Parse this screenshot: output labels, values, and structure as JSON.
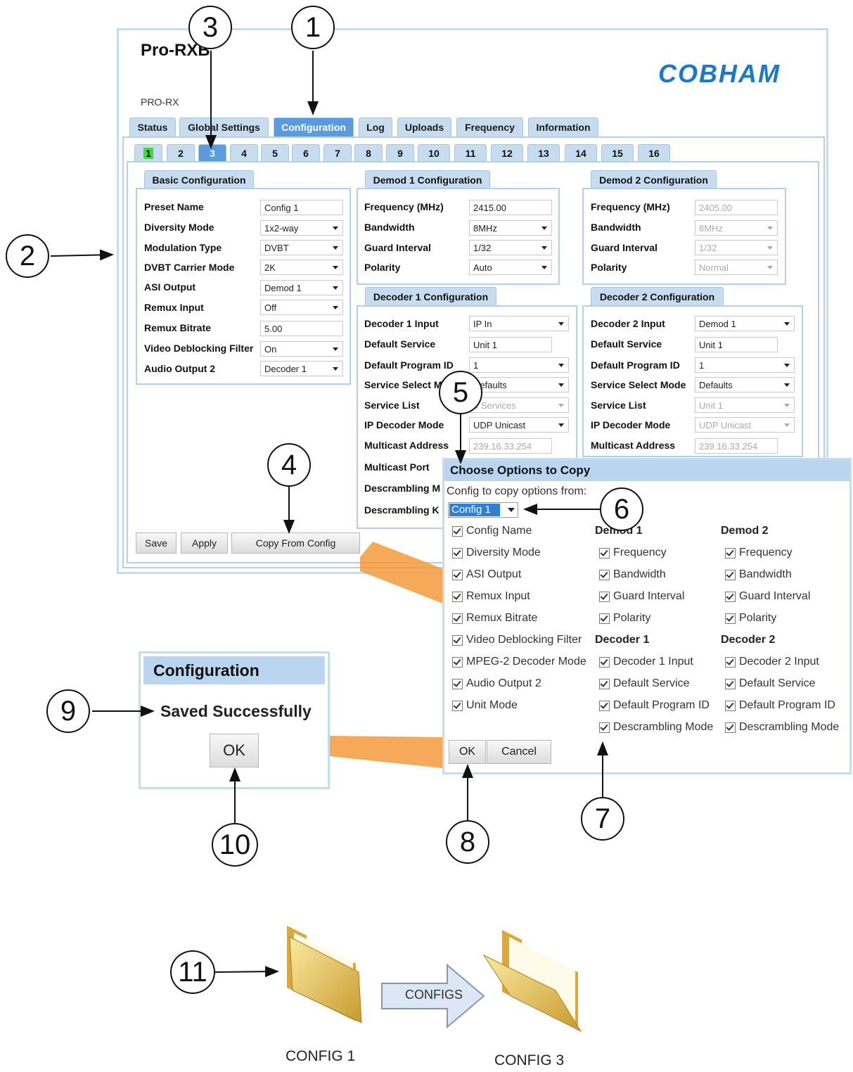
{
  "app": {
    "title": "Pro-RXB",
    "subtitle": "PRO-RX",
    "logo": "COBHAM"
  },
  "main_tabs": [
    "Status",
    "Global Settings",
    "Configuration",
    "Log",
    "Uploads",
    "Frequency",
    "Information"
  ],
  "number_tabs": [
    "1",
    "2",
    "3",
    "4",
    "5",
    "6",
    "7",
    "8",
    "9",
    "10",
    "11",
    "12",
    "13",
    "14",
    "15",
    "16"
  ],
  "basic": {
    "title": "Basic Configuration",
    "rows": [
      {
        "label": "Preset Name",
        "value": "Config 1"
      },
      {
        "label": "Diversity Mode",
        "value": "1x2-way"
      },
      {
        "label": "Modulation Type",
        "value": "DVBT"
      },
      {
        "label": "DVBT Carrier Mode",
        "value": "2K"
      },
      {
        "label": "ASI Output",
        "value": "Demod 1"
      },
      {
        "label": "Remux Input",
        "value": "Off"
      },
      {
        "label": "Remux Bitrate",
        "value": "5.00"
      },
      {
        "label": "Video Deblocking Filter",
        "value": "On"
      },
      {
        "label": "Audio Output 2",
        "value": "Decoder 1"
      }
    ]
  },
  "demod1": {
    "title": "Demod 1 Configuration",
    "rows": [
      {
        "label": "Frequency (MHz)",
        "value": "2415.00"
      },
      {
        "label": "Bandwidth",
        "value": "8MHz"
      },
      {
        "label": "Guard Interval",
        "value": "1/32"
      },
      {
        "label": "Polarity",
        "value": "Auto"
      }
    ]
  },
  "demod2": {
    "title": "Demod 2 Configuration",
    "rows": [
      {
        "label": "Frequency (MHz)",
        "value": "2405.00"
      },
      {
        "label": "Bandwidth",
        "value": "8MHz"
      },
      {
        "label": "Guard Interval",
        "value": "1/32"
      },
      {
        "label": "Polarity",
        "value": "Normal"
      }
    ]
  },
  "decoder1": {
    "title": "Decoder 1 Configuration",
    "rows": [
      {
        "label": "Decoder 1 Input",
        "value": "IP In"
      },
      {
        "label": "Default Service",
        "value": "Unit 1"
      },
      {
        "label": "Default Program ID",
        "value": "1"
      },
      {
        "label": "Service Select M",
        "value": "Defaults"
      },
      {
        "label": "Service List",
        "value": "3 Services"
      },
      {
        "label": "IP Decoder Mode",
        "value": "UDP Unicast"
      },
      {
        "label": "Multicast Address",
        "value": "239.16.33.254"
      },
      {
        "label": "Multicast Port",
        "value": ""
      },
      {
        "label": "Descrambling M",
        "value": ""
      },
      {
        "label": "Descrambling K",
        "value": ""
      }
    ]
  },
  "decoder2": {
    "title": "Decoder 2 Configuration",
    "rows": [
      {
        "label": "Decoder 2 Input",
        "value": "Demod 1"
      },
      {
        "label": "Default Service",
        "value": "Unit 1"
      },
      {
        "label": "Default Program ID",
        "value": "1"
      },
      {
        "label": "Service Select Mode",
        "value": "Defaults"
      },
      {
        "label": "Service List",
        "value": "Unit 1"
      },
      {
        "label": "IP Decoder Mode",
        "value": "UDP Unicast"
      },
      {
        "label": "Multicast Address",
        "value": "239.16.33.254"
      }
    ]
  },
  "buttons": {
    "save": "Save",
    "apply": "Apply",
    "copy": "Copy From Config"
  },
  "copy_dialog": {
    "title": "Choose Options to Copy",
    "from_label": "Config to copy options from:",
    "from_value": "Config 1",
    "col1": [
      "Config Name",
      "Diversity Mode",
      "ASI Output",
      "Remux Input",
      "Remux Bitrate",
      "Video Deblocking Filter",
      "MPEG-2 Decoder Mode",
      "Audio Output 2",
      "Unit Mode"
    ],
    "demod1_head": "Demod 1",
    "demod1": [
      "Frequency",
      "Bandwidth",
      "Guard Interval",
      "Polarity"
    ],
    "decoder1_head": "Decoder 1",
    "decoder1": [
      "Decoder 1 Input",
      "Default Service",
      "Default Program ID",
      "Descrambling Mode"
    ],
    "demod2_head": "Demod 2",
    "demod2": [
      "Frequency",
      "Bandwidth",
      "Guard Interval",
      "Polarity"
    ],
    "decoder2_head": "Decoder 2",
    "decoder2": [
      "Decoder 2 Input",
      "Default Service",
      "Default Program ID",
      "Descrambling Mode"
    ],
    "ok": "OK",
    "cancel": "Cancel"
  },
  "saved_dialog": {
    "title": "Configuration",
    "message": "Saved Successfully",
    "ok": "OK"
  },
  "callouts": [
    "1",
    "2",
    "3",
    "4",
    "5",
    "6",
    "7",
    "8",
    "9",
    "10",
    "11"
  ],
  "bottom": {
    "arrow_label": "CONFIGS",
    "from": "CONFIG 1",
    "to": "CONFIG 3"
  },
  "colors": {
    "accent": "#5a9be0",
    "tab": "#c8dcef",
    "logo": "#1c79c9",
    "arrow": "#f59a3c",
    "highlight": "#3ddc3d"
  }
}
